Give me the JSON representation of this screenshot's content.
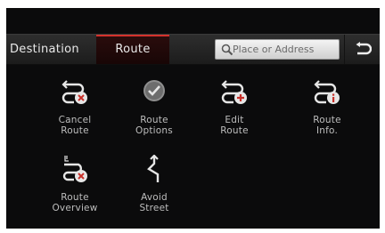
{
  "tabs": {
    "destination": "Destination",
    "route": "Route"
  },
  "search": {
    "placeholder": "Place or Address"
  },
  "menu": [
    {
      "line1": "Cancel",
      "line2": "Route",
      "icon": "cancel-route-icon"
    },
    {
      "line1": "Route",
      "line2": "Options",
      "icon": "route-options-icon"
    },
    {
      "line1": "Edit",
      "line2": "Route",
      "icon": "edit-route-icon"
    },
    {
      "line1": "Route",
      "line2": "Info.",
      "icon": "route-info-icon"
    },
    {
      "line1": "Route",
      "line2": "Overview",
      "icon": "route-overview-icon"
    },
    {
      "line1": "Avoid",
      "line2": "Street",
      "icon": "avoid-street-icon"
    }
  ],
  "colors": {
    "background": "#0b0b0c",
    "accent": "#d4322c",
    "text": "#bdbdbd"
  }
}
